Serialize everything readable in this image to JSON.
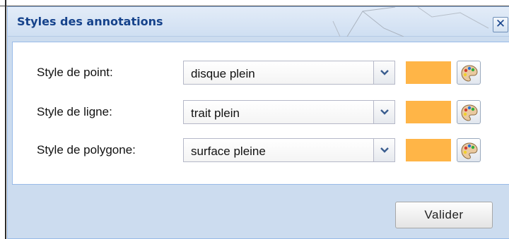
{
  "dialog": {
    "title": "Styles des annotations",
    "close_glyph": "✕"
  },
  "rows": [
    {
      "label": "Style de point:",
      "value": "disque plein",
      "color": "#ffb547",
      "icon": "palette-icon"
    },
    {
      "label": "Style de ligne:",
      "value": "trait plein",
      "color": "#ffb547",
      "icon": "palette-icon"
    },
    {
      "label": "Style de polygone:",
      "value": "surface pleine",
      "color": "#ffb547",
      "icon": "palette-icon"
    }
  ],
  "footer": {
    "validate_label": "Valider"
  },
  "colors": {
    "title": "#15428b",
    "panel_bg": "#ccdcef",
    "swatch": "#ffb547"
  }
}
